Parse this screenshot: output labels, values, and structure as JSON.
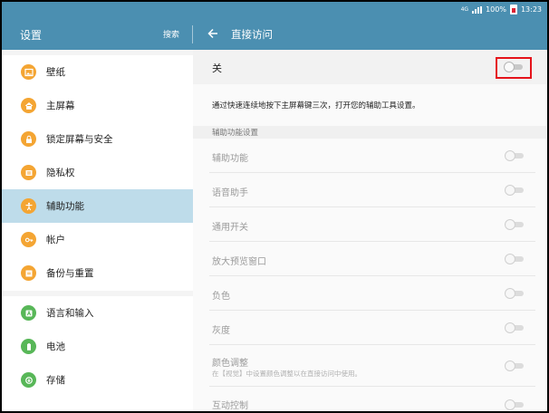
{
  "status_bar": {
    "network": "4G",
    "battery": "100%",
    "time": "13:23"
  },
  "header": {
    "left_title": "设置",
    "search_label": "搜索",
    "right_title": "直接访问"
  },
  "sidebar": {
    "items": [
      {
        "label": "壁纸",
        "icon": "wallpaper-icon",
        "color": "#f4a533"
      },
      {
        "label": "主屏幕",
        "icon": "home-icon",
        "color": "#f4a533"
      },
      {
        "label": "锁定屏幕与安全",
        "icon": "lock-icon",
        "color": "#f4a533"
      },
      {
        "label": "隐私权",
        "icon": "privacy-icon",
        "color": "#f4a533"
      },
      {
        "label": "辅助功能",
        "icon": "accessibility-icon",
        "color": "#f4a533",
        "active": true
      },
      {
        "label": "帐户",
        "icon": "key-icon",
        "color": "#f4a533"
      },
      {
        "label": "备份与重置",
        "icon": "backup-icon",
        "color": "#f4a533"
      },
      {
        "label": "语言和输入",
        "icon": "language-icon",
        "color": "#58b758"
      },
      {
        "label": "电池",
        "icon": "battery-icon",
        "color": "#58b758"
      },
      {
        "label": "存储",
        "icon": "storage-icon",
        "color": "#58b758"
      }
    ]
  },
  "main": {
    "master_label": "关",
    "master_on": false,
    "description": "通过快速连续地按下主屏幕键三次，打开您的辅助工具设置。",
    "section_title": "辅助功能设置",
    "settings": [
      {
        "label": "辅助功能"
      },
      {
        "label": "语音助手"
      },
      {
        "label": "通用开关"
      },
      {
        "label": "放大预览窗口"
      },
      {
        "label": "负色"
      },
      {
        "label": "灰度"
      },
      {
        "label": "颜色调整",
        "sub": "在【视觉】中设置颜色调整以在直接访问中使用。"
      },
      {
        "label": "互动控制"
      }
    ]
  },
  "colors": {
    "accent": "#4b8fb1",
    "active_item": "#bedcea",
    "highlight_box": "#e5131b"
  }
}
